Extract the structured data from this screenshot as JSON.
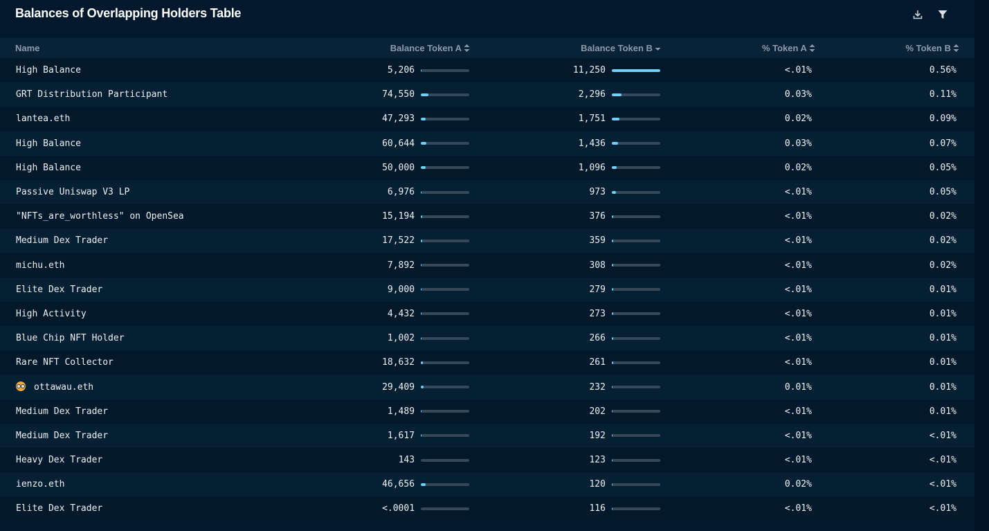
{
  "title": "Balances of Overlapping Holders Table",
  "toolbar": {
    "download_icon": "download-icon",
    "filter_icon": "filter-icon"
  },
  "colors": {
    "background": "#02192d",
    "header_row": "#082338",
    "row_alt": "#062033",
    "bar_track": "#36495a",
    "bar_fill": "#6fd0f8",
    "text": "#eef2f6",
    "header_text": "#8a9bab"
  },
  "columns": [
    {
      "key": "name",
      "label": "Name",
      "sort": "none",
      "sortable": false
    },
    {
      "key": "balance_a",
      "label": "Balance Token A",
      "sort": "unsorted",
      "sortable": true
    },
    {
      "key": "balance_b",
      "label": "Balance Token B",
      "sort": "descending",
      "sortable": true
    },
    {
      "key": "pct_a",
      "label": "% Token A",
      "sort": "unsorted",
      "sortable": true
    },
    {
      "key": "pct_b",
      "label": "% Token B",
      "sort": "unsorted",
      "sortable": true
    }
  ],
  "rows": [
    {
      "name": "High Balance",
      "avatar": false,
      "balance_a": "5,206",
      "bar_a": 0.01,
      "balance_b": "11,250",
      "bar_b": 1.0,
      "pct_a": "<.01%",
      "pct_b": "0.56%"
    },
    {
      "name": "GRT Distribution Participant",
      "avatar": false,
      "balance_a": "74,550",
      "bar_a": 0.15,
      "balance_b": "2,296",
      "bar_b": 0.2,
      "pct_a": "0.03%",
      "pct_b": "0.11%"
    },
    {
      "name": "lantea.eth",
      "avatar": false,
      "balance_a": "47,293",
      "bar_a": 0.1,
      "balance_b": "1,751",
      "bar_b": 0.16,
      "pct_a": "0.02%",
      "pct_b": "0.09%"
    },
    {
      "name": "High Balance",
      "avatar": false,
      "balance_a": "60,644",
      "bar_a": 0.12,
      "balance_b": "1,436",
      "bar_b": 0.13,
      "pct_a": "0.03%",
      "pct_b": "0.07%"
    },
    {
      "name": "High Balance",
      "avatar": false,
      "balance_a": "50,000",
      "bar_a": 0.1,
      "balance_b": "1,096",
      "bar_b": 0.1,
      "pct_a": "0.02%",
      "pct_b": "0.05%"
    },
    {
      "name": "Passive Uniswap V3 LP",
      "avatar": false,
      "balance_a": "6,976",
      "bar_a": 0.01,
      "balance_b": "973",
      "bar_b": 0.09,
      "pct_a": "<.01%",
      "pct_b": "0.05%"
    },
    {
      "name": "\"NFTs_are_worthless\" on OpenSea",
      "avatar": false,
      "balance_a": "15,194",
      "bar_a": 0.03,
      "balance_b": "376",
      "bar_b": 0.03,
      "pct_a": "<.01%",
      "pct_b": "0.02%"
    },
    {
      "name": "Medium Dex Trader",
      "avatar": false,
      "balance_a": "17,522",
      "bar_a": 0.03,
      "balance_b": "359",
      "bar_b": 0.03,
      "pct_a": "<.01%",
      "pct_b": "0.02%"
    },
    {
      "name": "michu.eth",
      "avatar": false,
      "balance_a": "7,892",
      "bar_a": 0.015,
      "balance_b": "308",
      "bar_b": 0.03,
      "pct_a": "<.01%",
      "pct_b": "0.02%"
    },
    {
      "name": "Elite Dex Trader",
      "avatar": false,
      "balance_a": "9,000",
      "bar_a": 0.015,
      "balance_b": "279",
      "bar_b": 0.025,
      "pct_a": "<.01%",
      "pct_b": "0.01%"
    },
    {
      "name": "High Activity",
      "avatar": false,
      "balance_a": "4,432",
      "bar_a": 0.01,
      "balance_b": "273",
      "bar_b": 0.025,
      "pct_a": "<.01%",
      "pct_b": "0.01%"
    },
    {
      "name": "Blue Chip NFT Holder",
      "avatar": false,
      "balance_a": "1,002",
      "bar_a": 0.005,
      "balance_b": "266",
      "bar_b": 0.025,
      "pct_a": "<.01%",
      "pct_b": "0.01%"
    },
    {
      "name": "Rare NFT Collector",
      "avatar": false,
      "balance_a": "18,632",
      "bar_a": 0.04,
      "balance_b": "261",
      "bar_b": 0.025,
      "pct_a": "<.01%",
      "pct_b": "0.01%"
    },
    {
      "name": "ottawau.eth",
      "avatar": true,
      "balance_a": "29,409",
      "bar_a": 0.06,
      "balance_b": "232",
      "bar_b": 0.02,
      "pct_a": "0.01%",
      "pct_b": "0.01%"
    },
    {
      "name": "Medium Dex Trader",
      "avatar": false,
      "balance_a": "1,489",
      "bar_a": 0.005,
      "balance_b": "202",
      "bar_b": 0.02,
      "pct_a": "<.01%",
      "pct_b": "0.01%"
    },
    {
      "name": "Medium Dex Trader",
      "avatar": false,
      "balance_a": "1,617",
      "bar_a": 0.005,
      "balance_b": "192",
      "bar_b": 0.017,
      "pct_a": "<.01%",
      "pct_b": "<.01%"
    },
    {
      "name": "Heavy Dex Trader",
      "avatar": false,
      "balance_a": "143",
      "bar_a": 0.0,
      "balance_b": "123",
      "bar_b": 0.011,
      "pct_a": "<.01%",
      "pct_b": "<.01%"
    },
    {
      "name": "ienzo.eth",
      "avatar": false,
      "balance_a": "46,656",
      "bar_a": 0.1,
      "balance_b": "120",
      "bar_b": 0.011,
      "pct_a": "0.02%",
      "pct_b": "<.01%"
    },
    {
      "name": "Elite Dex Trader",
      "avatar": false,
      "balance_a": "<.0001",
      "bar_a": 0.0,
      "balance_b": "116",
      "bar_b": 0.01,
      "pct_a": "<.01%",
      "pct_b": "<.01%"
    }
  ]
}
